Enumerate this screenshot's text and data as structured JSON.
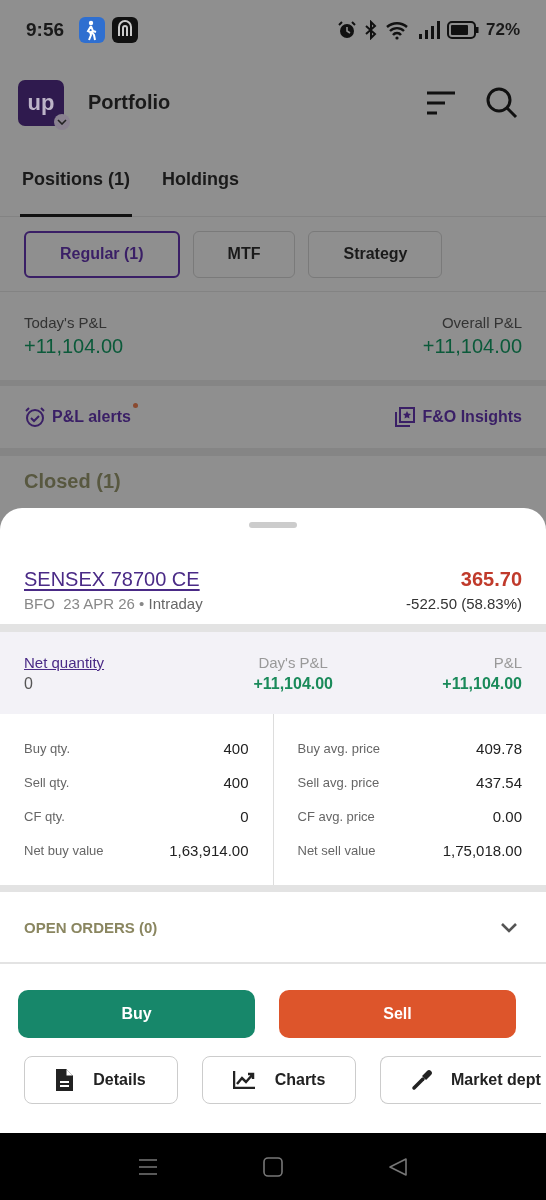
{
  "status_bar": {
    "time": "9:56",
    "battery": "72%"
  },
  "header": {
    "logo": "up",
    "title": "Portfolio"
  },
  "tabs": [
    {
      "label": "Positions (1)",
      "selected": true
    },
    {
      "label": "Holdings",
      "selected": false
    }
  ],
  "filters": [
    {
      "label": "Regular (1)",
      "selected": true
    },
    {
      "label": "MTF",
      "selected": false
    },
    {
      "label": "Strategy",
      "selected": false
    }
  ],
  "summary": {
    "today_label": "Today's P&L",
    "today_value": "+11,104.00",
    "overall_label": "Overall P&L",
    "overall_value": "+11,104.00"
  },
  "alerts": {
    "label": "P&L alerts",
    "new": true,
    "insights": "F&O Insights"
  },
  "section_title": "Closed (1)",
  "sheet": {
    "symbol": "SENSEX 78700 CE",
    "exchange": "BFO",
    "expiry": "23 APR 26",
    "separator": "•",
    "product": "Intraday",
    "price": "365.70",
    "change": "-522.50 (58.83%)",
    "net_qty_label": "Net quantity",
    "net_qty": "0",
    "day_pl_label": "Day's P&L",
    "day_pl": "+11,104.00",
    "pl_label": "P&L",
    "pl": "+11,104.00",
    "left": [
      {
        "label": "Buy qty.",
        "value": "400"
      },
      {
        "label": "Sell qty.",
        "value": "400"
      },
      {
        "label": "CF qty.",
        "value": "0"
      },
      {
        "label": "Net buy value",
        "value": "1,63,914.00"
      }
    ],
    "right": [
      {
        "label": "Buy avg. price",
        "value": "409.78"
      },
      {
        "label": "Sell avg. price",
        "value": "437.54"
      },
      {
        "label": "CF avg. price",
        "value": "0.00"
      },
      {
        "label": "Net sell value",
        "value": "1,75,018.00"
      }
    ],
    "open_orders": {
      "label": "OPEN ORDERS (0)",
      "expanded": false
    },
    "actions": [
      {
        "label": "Buy",
        "kind": "buy"
      },
      {
        "label": "Sell",
        "kind": "sell"
      }
    ],
    "links": [
      {
        "label": "Details",
        "kind": "details"
      },
      {
        "label": "Charts",
        "kind": "charts"
      },
      {
        "label": "Market dept",
        "kind": "depth"
      }
    ]
  }
}
